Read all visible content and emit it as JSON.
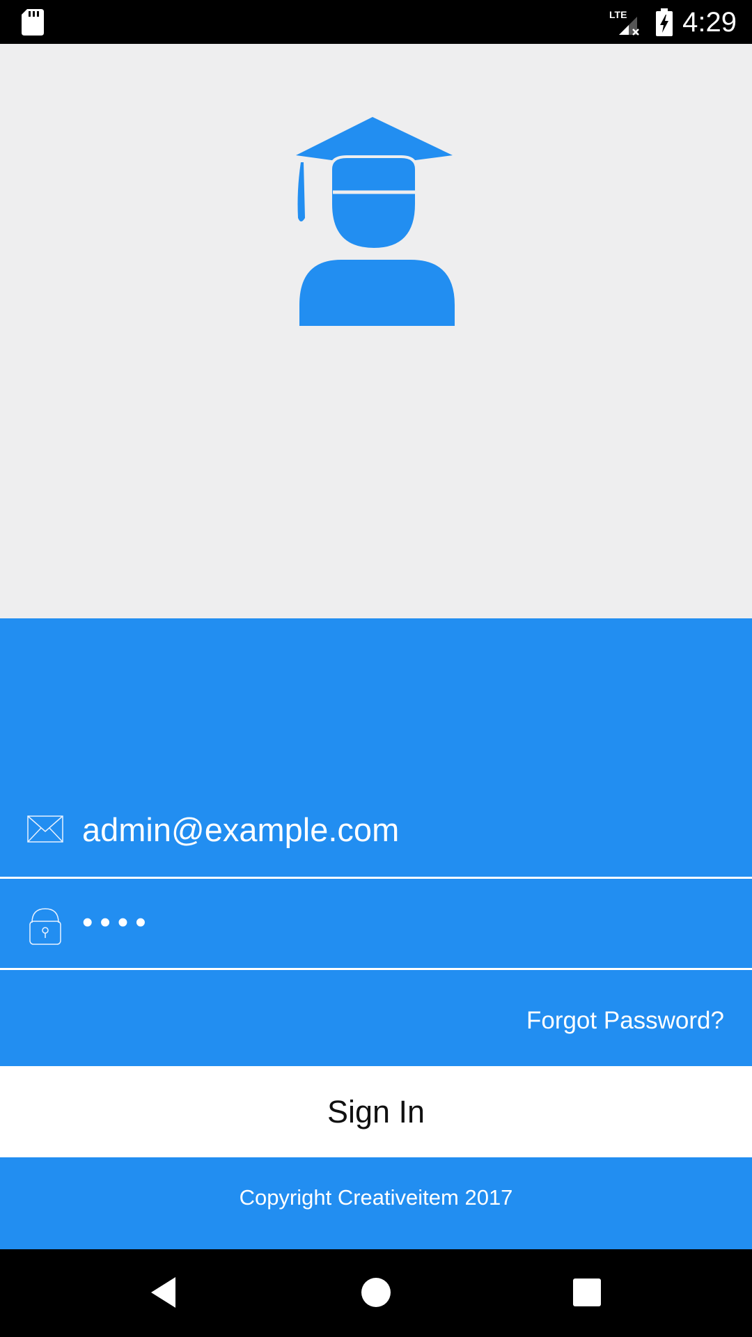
{
  "status_bar": {
    "time": "4:29",
    "icons": [
      "sd-card-icon",
      "lte-signal-icon",
      "battery-charging-icon"
    ]
  },
  "login": {
    "logo_icon": "graduate-student-icon",
    "email": {
      "icon": "envelope-icon",
      "value": "admin@example.com"
    },
    "password": {
      "icon": "padlock-icon",
      "value": "••••"
    },
    "forgot_password_label": "Forgot Password?",
    "sign_in_label": "Sign In",
    "copyright": "Copyright Creativeitem 2017"
  },
  "nav_bar": {
    "icons": [
      "back-icon",
      "home-icon",
      "recents-icon"
    ]
  },
  "colors": {
    "primary": "#228ef1",
    "hero_background": "#eeeeef",
    "button_background": "#ffffff"
  }
}
